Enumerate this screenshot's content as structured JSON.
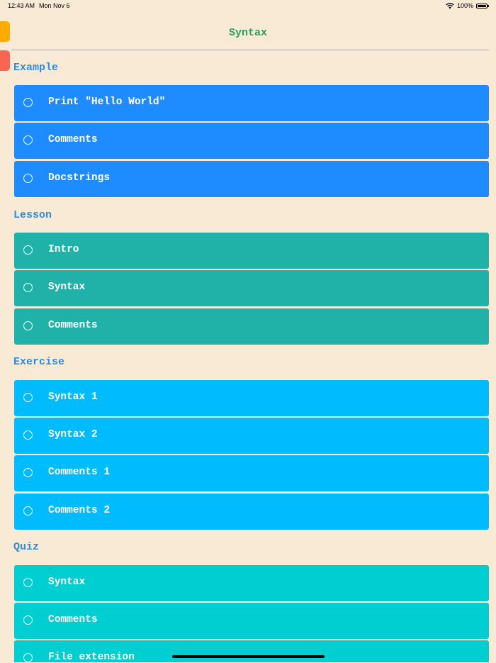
{
  "status": {
    "time": "12:43 AM",
    "date": "Mon Nov 6",
    "battery": "100%"
  },
  "nav": {
    "title": "Syntax"
  },
  "sections": {
    "example": {
      "title": "Example",
      "items": [
        "Print \"Hello World\"",
        "Comments",
        "Docstrings"
      ]
    },
    "lesson": {
      "title": "Lesson",
      "items": [
        "Intro",
        "Syntax",
        "Comments"
      ]
    },
    "exercise": {
      "title": "Exercise",
      "items": [
        "Syntax 1",
        "Syntax 2",
        "Comments 1",
        "Comments 2"
      ]
    },
    "quiz": {
      "title": "Quiz",
      "items": [
        "Syntax",
        "Comments",
        "File extension"
      ]
    }
  },
  "colors": {
    "background": "#f9ead6",
    "title": "#1fa463",
    "section_title": "#2e8de0",
    "example_rows": "#1e8bff",
    "lesson_rows": "#20b2a9",
    "exercise_rows": "#00bcff",
    "quiz_rows": "#00ced1"
  }
}
